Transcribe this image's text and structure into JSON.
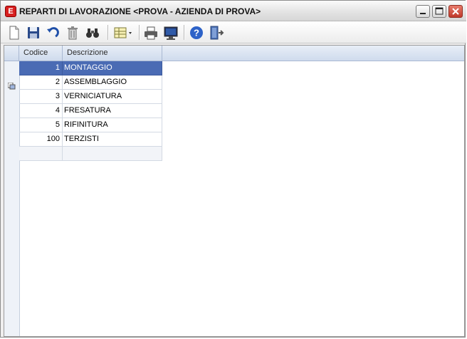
{
  "window": {
    "title": "REPARTI DI LAVORAZIONE <PROVA - AZIENDA DI PROVA>",
    "buttons": [
      "minimize",
      "maximize",
      "close"
    ]
  },
  "toolbar": {
    "buttons": [
      "new-icon",
      "save-icon",
      "undo-icon",
      "delete-icon",
      "find-icon",
      "columns-icon",
      "print-icon",
      "preview-icon",
      "help-icon",
      "exit-icon"
    ]
  },
  "grid": {
    "columns": [
      "Codice",
      "Descrizione"
    ],
    "rows": [
      {
        "code": "1",
        "description": "MONTAGGIO",
        "selected": true
      },
      {
        "code": "2",
        "description": "ASSEMBLAGGIO"
      },
      {
        "code": "3",
        "description": "VERNICIATURA"
      },
      {
        "code": "4",
        "description": "FRESATURA"
      },
      {
        "code": "5",
        "description": "RIFINITURA"
      },
      {
        "code": "100",
        "description": "TERZISTI"
      },
      {
        "code": "",
        "description": ""
      }
    ]
  },
  "colors": {
    "selection": "#4a6bb4",
    "header": "#cfdbed",
    "close_button": "#c0392b"
  }
}
